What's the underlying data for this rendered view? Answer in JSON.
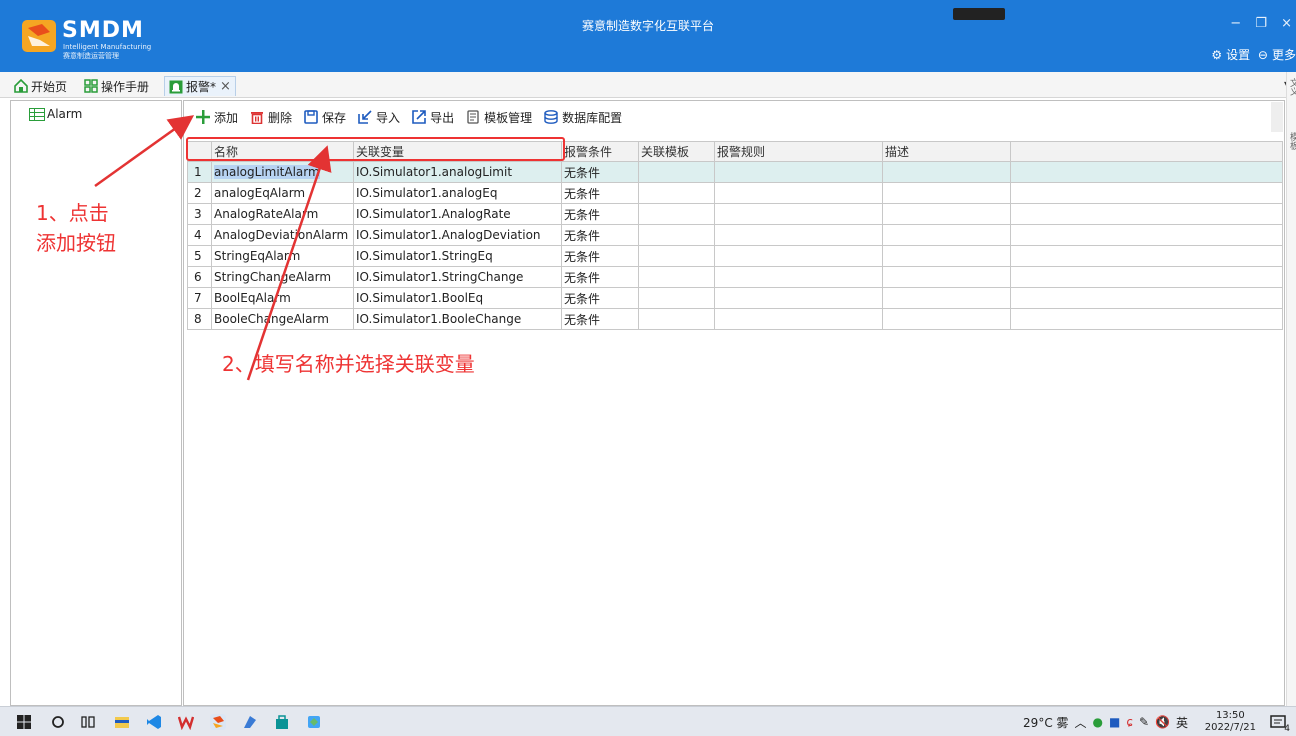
{
  "titlebar": {
    "brand": "SMDM",
    "brand_sub1": "Intelligent Manufacturing",
    "brand_sub2": "赛意制造运营管理",
    "app_title": "赛意制造数字化互联平台",
    "settings_label": "设置",
    "more_label": "更多",
    "minimize": "−",
    "restore": "❐",
    "close": "×",
    "accent_color": "#1e7ad8"
  },
  "tabs": [
    {
      "label": "开始页",
      "icon": "home-icon"
    },
    {
      "label": "操作手册",
      "icon": "grid-icon"
    },
    {
      "label": "报警*",
      "icon": "alarm-icon",
      "active": true
    }
  ],
  "tab_close": "×",
  "tab_menu": "▾",
  "right_strip": [
    "文义",
    "模板"
  ],
  "tree": {
    "item": "Alarm"
  },
  "toolbar": {
    "add": "添加",
    "delete": "删除",
    "save": "保存",
    "import": "导入",
    "export": "导出",
    "template": "模板管理",
    "db": "数据库配置"
  },
  "table": {
    "headers": [
      "名称",
      "关联变量",
      "报警条件",
      "关联模板",
      "报警规则",
      "描述",
      ""
    ],
    "rows": [
      {
        "n": "1",
        "name": "analogLimitAlarm",
        "var": "IO.Simulator1.analogLimit",
        "cond": "无条件"
      },
      {
        "n": "2",
        "name": "analogEqAlarm",
        "var": "IO.Simulator1.analogEq",
        "cond": "无条件"
      },
      {
        "n": "3",
        "name": "AnalogRateAlarm",
        "var": "IO.Simulator1.AnalogRate",
        "cond": "无条件"
      },
      {
        "n": "4",
        "name": "AnalogDeviationAlarm",
        "var": "IO.Simulator1.AnalogDeviation",
        "cond": "无条件"
      },
      {
        "n": "5",
        "name": "StringEqAlarm",
        "var": "IO.Simulator1.StringEq",
        "cond": "无条件"
      },
      {
        "n": "6",
        "name": "StringChangeAlarm",
        "var": "IO.Simulator1.StringChange",
        "cond": "无条件"
      },
      {
        "n": "7",
        "name": "BoolEqAlarm",
        "var": "IO.Simulator1.BoolEq",
        "cond": "无条件"
      },
      {
        "n": "8",
        "name": "BooleChangeAlarm",
        "var": "IO.Simulator1.BooleChange",
        "cond": "无条件"
      }
    ]
  },
  "annotations": {
    "step1_line1": "1、点击",
    "step1_line2": "添加按钮",
    "step2": "2、填写名称并选择关联变量",
    "color": "#e33333"
  },
  "taskbar": {
    "weather": "29°C 雾",
    "ime": "英",
    "time": "13:50",
    "date": "2022/7/21",
    "notif_count": "4"
  }
}
